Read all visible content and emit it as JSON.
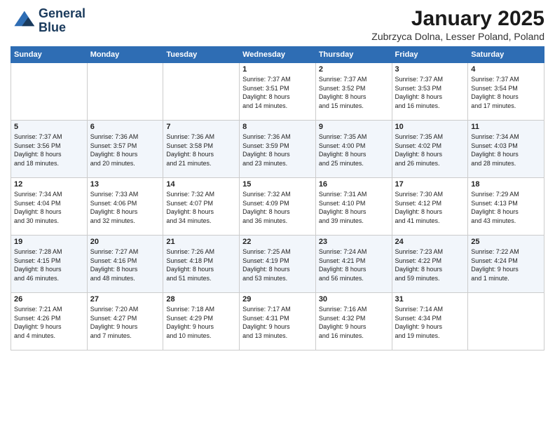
{
  "logo": {
    "line1": "General",
    "line2": "Blue"
  },
  "title": "January 2025",
  "location": "Zubrzyca Dolna, Lesser Poland, Poland",
  "days_of_week": [
    "Sunday",
    "Monday",
    "Tuesday",
    "Wednesday",
    "Thursday",
    "Friday",
    "Saturday"
  ],
  "weeks": [
    [
      {
        "num": "",
        "info": ""
      },
      {
        "num": "",
        "info": ""
      },
      {
        "num": "",
        "info": ""
      },
      {
        "num": "1",
        "info": "Sunrise: 7:37 AM\nSunset: 3:51 PM\nDaylight: 8 hours\nand 14 minutes."
      },
      {
        "num": "2",
        "info": "Sunrise: 7:37 AM\nSunset: 3:52 PM\nDaylight: 8 hours\nand 15 minutes."
      },
      {
        "num": "3",
        "info": "Sunrise: 7:37 AM\nSunset: 3:53 PM\nDaylight: 8 hours\nand 16 minutes."
      },
      {
        "num": "4",
        "info": "Sunrise: 7:37 AM\nSunset: 3:54 PM\nDaylight: 8 hours\nand 17 minutes."
      }
    ],
    [
      {
        "num": "5",
        "info": "Sunrise: 7:37 AM\nSunset: 3:56 PM\nDaylight: 8 hours\nand 18 minutes."
      },
      {
        "num": "6",
        "info": "Sunrise: 7:36 AM\nSunset: 3:57 PM\nDaylight: 8 hours\nand 20 minutes."
      },
      {
        "num": "7",
        "info": "Sunrise: 7:36 AM\nSunset: 3:58 PM\nDaylight: 8 hours\nand 21 minutes."
      },
      {
        "num": "8",
        "info": "Sunrise: 7:36 AM\nSunset: 3:59 PM\nDaylight: 8 hours\nand 23 minutes."
      },
      {
        "num": "9",
        "info": "Sunrise: 7:35 AM\nSunset: 4:00 PM\nDaylight: 8 hours\nand 25 minutes."
      },
      {
        "num": "10",
        "info": "Sunrise: 7:35 AM\nSunset: 4:02 PM\nDaylight: 8 hours\nand 26 minutes."
      },
      {
        "num": "11",
        "info": "Sunrise: 7:34 AM\nSunset: 4:03 PM\nDaylight: 8 hours\nand 28 minutes."
      }
    ],
    [
      {
        "num": "12",
        "info": "Sunrise: 7:34 AM\nSunset: 4:04 PM\nDaylight: 8 hours\nand 30 minutes."
      },
      {
        "num": "13",
        "info": "Sunrise: 7:33 AM\nSunset: 4:06 PM\nDaylight: 8 hours\nand 32 minutes."
      },
      {
        "num": "14",
        "info": "Sunrise: 7:32 AM\nSunset: 4:07 PM\nDaylight: 8 hours\nand 34 minutes."
      },
      {
        "num": "15",
        "info": "Sunrise: 7:32 AM\nSunset: 4:09 PM\nDaylight: 8 hours\nand 36 minutes."
      },
      {
        "num": "16",
        "info": "Sunrise: 7:31 AM\nSunset: 4:10 PM\nDaylight: 8 hours\nand 39 minutes."
      },
      {
        "num": "17",
        "info": "Sunrise: 7:30 AM\nSunset: 4:12 PM\nDaylight: 8 hours\nand 41 minutes."
      },
      {
        "num": "18",
        "info": "Sunrise: 7:29 AM\nSunset: 4:13 PM\nDaylight: 8 hours\nand 43 minutes."
      }
    ],
    [
      {
        "num": "19",
        "info": "Sunrise: 7:28 AM\nSunset: 4:15 PM\nDaylight: 8 hours\nand 46 minutes."
      },
      {
        "num": "20",
        "info": "Sunrise: 7:27 AM\nSunset: 4:16 PM\nDaylight: 8 hours\nand 48 minutes."
      },
      {
        "num": "21",
        "info": "Sunrise: 7:26 AM\nSunset: 4:18 PM\nDaylight: 8 hours\nand 51 minutes."
      },
      {
        "num": "22",
        "info": "Sunrise: 7:25 AM\nSunset: 4:19 PM\nDaylight: 8 hours\nand 53 minutes."
      },
      {
        "num": "23",
        "info": "Sunrise: 7:24 AM\nSunset: 4:21 PM\nDaylight: 8 hours\nand 56 minutes."
      },
      {
        "num": "24",
        "info": "Sunrise: 7:23 AM\nSunset: 4:22 PM\nDaylight: 8 hours\nand 59 minutes."
      },
      {
        "num": "25",
        "info": "Sunrise: 7:22 AM\nSunset: 4:24 PM\nDaylight: 9 hours\nand 1 minute."
      }
    ],
    [
      {
        "num": "26",
        "info": "Sunrise: 7:21 AM\nSunset: 4:26 PM\nDaylight: 9 hours\nand 4 minutes."
      },
      {
        "num": "27",
        "info": "Sunrise: 7:20 AM\nSunset: 4:27 PM\nDaylight: 9 hours\nand 7 minutes."
      },
      {
        "num": "28",
        "info": "Sunrise: 7:18 AM\nSunset: 4:29 PM\nDaylight: 9 hours\nand 10 minutes."
      },
      {
        "num": "29",
        "info": "Sunrise: 7:17 AM\nSunset: 4:31 PM\nDaylight: 9 hours\nand 13 minutes."
      },
      {
        "num": "30",
        "info": "Sunrise: 7:16 AM\nSunset: 4:32 PM\nDaylight: 9 hours\nand 16 minutes."
      },
      {
        "num": "31",
        "info": "Sunrise: 7:14 AM\nSunset: 4:34 PM\nDaylight: 9 hours\nand 19 minutes."
      },
      {
        "num": "",
        "info": ""
      }
    ]
  ]
}
